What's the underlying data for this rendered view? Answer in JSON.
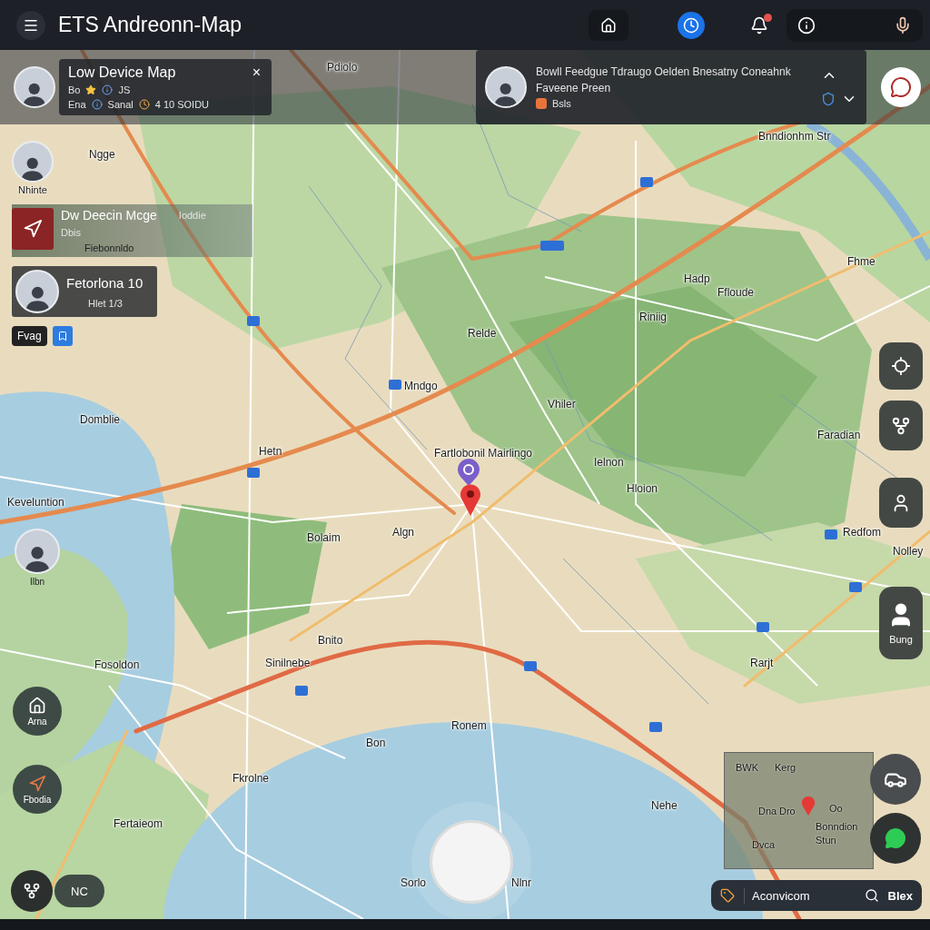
{
  "app_bar": {
    "title": "ETS Andreonn-Map"
  },
  "top_left_card": {
    "title": "Low Device Map",
    "close": "×",
    "line_1": "Bo",
    "line_1_tag": "JS",
    "meta_a": "Ena",
    "meta_b": "Sanal",
    "meta_c": "4 10 SOIDU"
  },
  "top_right_card": {
    "title": "Bowll Feedgue Tdraugo Oelden Bnesatny Coneahnk",
    "subtitle": "Faveene Preen",
    "meta": "Bsls"
  },
  "left_panel": {
    "person": {
      "label": "Nhinte"
    },
    "route_card": {
      "title": "Dw Deecin Mcge",
      "badge": "Ioddie",
      "subtitle": "Dbis",
      "footer": "Fiebonnldo"
    },
    "person_card": {
      "title": "Fetorlona 10",
      "subtitle": "Hlet 1/3"
    },
    "chip": {
      "label": "Fvag"
    }
  },
  "left_fabs": [
    {
      "kind": "avatar",
      "label": "Ilbn"
    },
    {
      "kind": "home",
      "label": "Arna"
    },
    {
      "kind": "navigate",
      "label": "Fbodia"
    }
  ],
  "bottom_left_pill": {
    "label": "NC"
  },
  "right_controls": [
    {
      "kind": "target"
    },
    {
      "kind": "fork"
    },
    {
      "kind": "person"
    },
    {
      "kind": "profile",
      "label": "Bung"
    }
  ],
  "map_labels": [
    "Pdiolo",
    "Bnndionhm Str",
    "Ngge",
    "Fhme",
    "Hadp",
    "Ffloude",
    "Riniig",
    "Relde",
    "Mndgo",
    "Vhiler",
    "Domblie",
    "Faradian",
    "Hetn",
    "Fartlobonil Mairlingo",
    "Ielnon",
    "Hloion",
    "Keveluntion",
    "Bolaim",
    "Algn",
    "Redfom",
    "Nolley",
    "Bnito",
    "Fosoldon",
    "Sinilnebe",
    "Rarjt",
    "Ronem",
    "Bon",
    "Fkrolne",
    "Nehe",
    "Fertaieom",
    "Sorlo",
    "Nlnr"
  ],
  "minimap": {
    "labels": [
      "BWK",
      "Kerg",
      "Dna",
      "Dro",
      "Oo",
      "Bonndion",
      "Dvca",
      "Stun"
    ]
  },
  "search_bar": {
    "value": "Aconvicom",
    "label": "Blex"
  }
}
